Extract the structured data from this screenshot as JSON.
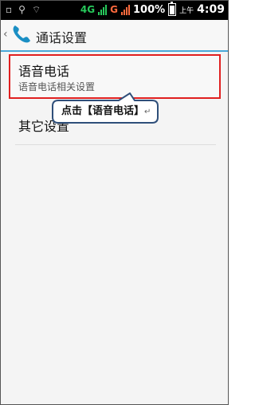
{
  "status_bar": {
    "left_icons": [
      "sim-card-icon",
      "usb-icon",
      "wifi-icon"
    ],
    "network_1": "4G",
    "network_2": "G",
    "battery_percent": "100%",
    "time_prefix": "上午",
    "time": "4:09",
    "colors": {
      "network_1": "#27c95b",
      "network_2": "#ff6a3d"
    }
  },
  "action_bar": {
    "back_symbol": "‹",
    "icon": "phone-icon",
    "title": "通话设置"
  },
  "settings": {
    "voice_call": {
      "title": "语音电话",
      "subtitle": "语音电话相关设置"
    },
    "other": {
      "title": "其它设置"
    }
  },
  "callout": {
    "text": "点击【语音电话】",
    "return_mark": "↵"
  },
  "colors": {
    "highlight_border": "#e02020",
    "accent_line": "#4aa8d8",
    "phone_icon": "#1b8fc4"
  }
}
